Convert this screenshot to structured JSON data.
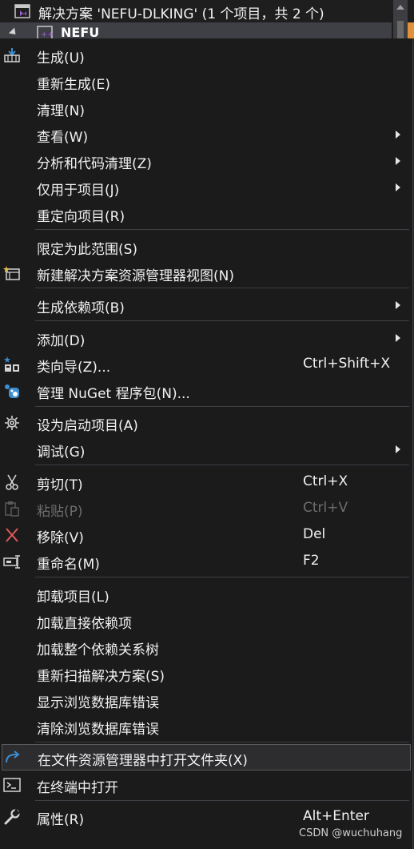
{
  "solution_explorer": {
    "solution_label": "解决方案 'NEFU-DLKING' (1 个项目，共 2 个)",
    "project_label": "NEFU"
  },
  "menu": {
    "items": [
      {
        "label": "生成(U)",
        "icon": "build-icon"
      },
      {
        "label": "重新生成(E)"
      },
      {
        "label": "清理(N)"
      },
      {
        "label": "查看(W)",
        "submenu": true
      },
      {
        "label": "分析和代码清理(Z)",
        "submenu": true
      },
      {
        "label": "仅用于项目(J)",
        "submenu": true
      },
      {
        "label": "重定向项目(R)"
      },
      {
        "label": "限定为此范围(S)"
      },
      {
        "label": "新建解决方案资源管理器视图(N)",
        "icon": "new-view-icon"
      },
      {
        "label": "生成依赖项(B)",
        "submenu": true
      },
      {
        "label": "添加(D)",
        "submenu": true
      },
      {
        "label": "类向导(Z)...",
        "shortcut": "Ctrl+Shift+X",
        "icon": "class-wizard-icon"
      },
      {
        "label": "管理 NuGet 程序包(N)...",
        "icon": "nuget-icon"
      },
      {
        "label": "设为启动项目(A)",
        "icon": "gear-icon"
      },
      {
        "label": "调试(G)",
        "submenu": true
      },
      {
        "label": "剪切(T)",
        "shortcut": "Ctrl+X",
        "icon": "scissors-icon"
      },
      {
        "label": "粘贴(P)",
        "shortcut": "Ctrl+V",
        "icon": "paste-icon",
        "disabled": true
      },
      {
        "label": "移除(V)",
        "shortcut": "Del",
        "icon": "remove-x-icon"
      },
      {
        "label": "重命名(M)",
        "shortcut": "F2",
        "icon": "rename-icon"
      },
      {
        "label": "卸载项目(L)"
      },
      {
        "label": "加载直接依赖项"
      },
      {
        "label": "加载整个依赖关系树"
      },
      {
        "label": "重新扫描解决方案(S)"
      },
      {
        "label": "显示浏览数据库错误"
      },
      {
        "label": "清除浏览数据库错误"
      },
      {
        "label": "在文件资源管理器中打开文件夹(X)",
        "icon": "open-folder-arrow-icon",
        "highlighted": true
      },
      {
        "label": "在终端中打开",
        "icon": "terminal-icon"
      },
      {
        "label": "属性(R)",
        "shortcut": "Alt+Enter",
        "icon": "wrench-icon"
      }
    ]
  },
  "watermark": "CSDN @wuchuhang",
  "colors": {
    "menu_bg": "#1b1b1c",
    "highlight_bg": "#2d2d30",
    "separator": "#3f3f46",
    "remove_red": "#e05a5a",
    "accent_blue": "#3e8ed0",
    "vs_purple": "#9b5fd1"
  }
}
